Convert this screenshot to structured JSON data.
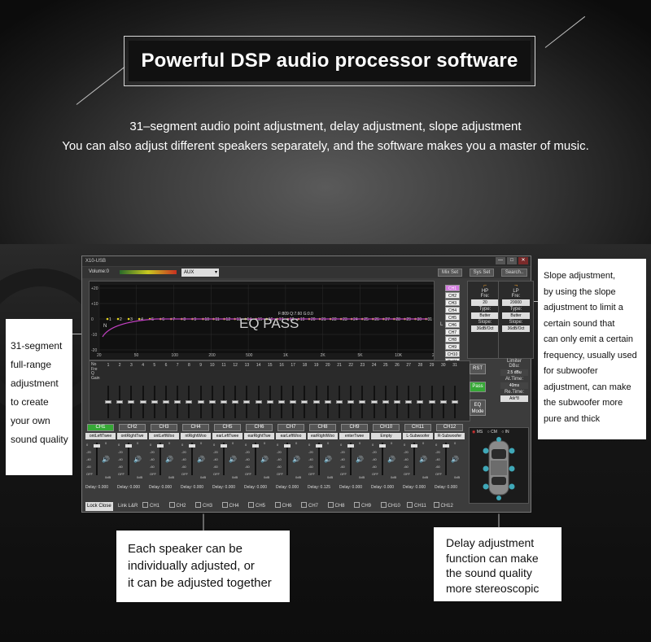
{
  "banner": {
    "title": "Powerful DSP audio processor software",
    "line1": "31–segment audio point adjustment, delay adjustment, slope adjustment",
    "line2": "You can also adjust different speakers separately, and the software makes you a master of music."
  },
  "callouts": {
    "left": [
      "31-segment",
      "full-range",
      "adjustment",
      "to create",
      "your own",
      "sound quality"
    ],
    "right": [
      "Slope adjustment,",
      "by using the slope",
      "adjustment to limit a",
      "certain sound that",
      "can only emit a certain",
      "frequency, usually used",
      "for subwoofer",
      "adjustment, can make",
      "the subwoofer more",
      "pure and thick"
    ],
    "bottom_left": [
      "Each speaker can be",
      "individually adjusted, or",
      "it can be adjusted together"
    ],
    "bottom_right": [
      "Delay adjustment",
      "function can make",
      "the sound quality",
      "more stereoscopic"
    ]
  },
  "app": {
    "window_title": "X10-USB",
    "win_min": "—",
    "win_max": "□",
    "win_close": "✕",
    "volume_label": "Volume:0",
    "source": "AUX",
    "mix_set": "Mix Set",
    "sys_set": "Sys Set",
    "search": "Search..",
    "eq_overlay": "EQ PASS",
    "eq_info": "F:809 Q:7.60 G:0.0",
    "point_n": "N",
    "point_l": "L",
    "y_labels": [
      "+20",
      "+10",
      "0",
      "-10",
      "-20"
    ],
    "x_labels": [
      "20",
      "50",
      "100",
      "200",
      "500",
      "1K",
      "2K",
      "5K",
      "10K",
      "20K"
    ],
    "band_numbers": [
      "1",
      "2",
      "3",
      "4",
      "5",
      "6",
      "7",
      "8",
      "9",
      "10",
      "11",
      "12",
      "13",
      "14",
      "15",
      "16",
      "17",
      "18",
      "19",
      "20",
      "21",
      "22",
      "23",
      "24",
      "25",
      "26",
      "27",
      "28",
      "29",
      "30",
      "31"
    ],
    "eq_channels": [
      "CH1",
      "CH2",
      "CH3",
      "CH4",
      "CH5",
      "CH6",
      "CH7",
      "CH8",
      "CH9",
      "CH10",
      "CH11",
      "CH12"
    ],
    "hp": {
      "label": "HP",
      "fre_label": "Fre:",
      "fre": "20",
      "type_label": "Type:",
      "type": "Butter",
      "slope_label": "Slope:",
      "slope": "36dB/Oct"
    },
    "lp": {
      "label": "LP",
      "fre_label": "Fre:",
      "fre": "20000",
      "type_label": "Type:",
      "type": "Butter",
      "slope_label": "Slope:",
      "slope": "36dB/Oct"
    },
    "row_labels": [
      "No",
      "Fre",
      "Q",
      "Gain"
    ],
    "rst": "RST",
    "pass": "Pass",
    "eq_mode_1": "EQ",
    "eq_mode_2": "Mode",
    "limiter": {
      "title": "Limiter",
      "dbu_label": "DBu:",
      "dbu": "2.5 dBu",
      "at_label": "At.Time:",
      "at": "40ms",
      "re_label": "Re.Time:",
      "re": "Atk*8"
    },
    "channels": [
      {
        "name": "CH1",
        "speaker": "ontLeftTwee",
        "delay": "Delay: 0.000",
        "active": true
      },
      {
        "name": "CH2",
        "speaker": "ontRightTwe",
        "delay": "Delay: 0.000",
        "active": false
      },
      {
        "name": "CH3",
        "speaker": "ontLeftWoo",
        "delay": "Delay: 0.000",
        "active": false
      },
      {
        "name": "CH4",
        "speaker": "ntRightWoo",
        "delay": "Delay: 0.000",
        "active": false
      },
      {
        "name": "CH5",
        "speaker": "earLeftTwee",
        "delay": "Delay: 0.000",
        "active": false
      },
      {
        "name": "CH6",
        "speaker": "earRightTwe",
        "delay": "Delay: 0.000",
        "active": false
      },
      {
        "name": "CH7",
        "speaker": "earLeftWoo",
        "delay": "Delay: 0.000",
        "active": false
      },
      {
        "name": "CH8",
        "speaker": "earRightWoo",
        "delay": "Delay: 0.125",
        "active": false
      },
      {
        "name": "CH9",
        "speaker": "enterTwee",
        "delay": "Delay: 0.000",
        "active": false
      },
      {
        "name": "CH10",
        "speaker": "Empty",
        "delay": "Delay: 0.000",
        "active": false
      },
      {
        "name": "CH11",
        "speaker": "L-Subwoofer",
        "delay": "Delay: 0.000",
        "active": false
      },
      {
        "name": "CH12",
        "speaker": "R-Subwoofer",
        "delay": "Delay: 0.000",
        "active": false
      }
    ],
    "fader_labels": {
      "top": "0",
      "m20": "-20",
      "m40": "-40",
      "m60": "-60",
      "off": "OFF",
      "odb": "0dB"
    },
    "car_modes": [
      "MS",
      "CM",
      "IN"
    ],
    "lock_close": "Lock Close",
    "link": "Link L&R",
    "link_channels": [
      "CH1",
      "CH2",
      "CH3",
      "CH4",
      "CH5",
      "CH6",
      "CH7",
      "CH8",
      "CH9",
      "CH10",
      "CH11",
      "CH12"
    ]
  },
  "colors": {
    "accent_green": "#36a836",
    "eq_curve": "#c040c0",
    "eq_point": "#e8d820"
  }
}
